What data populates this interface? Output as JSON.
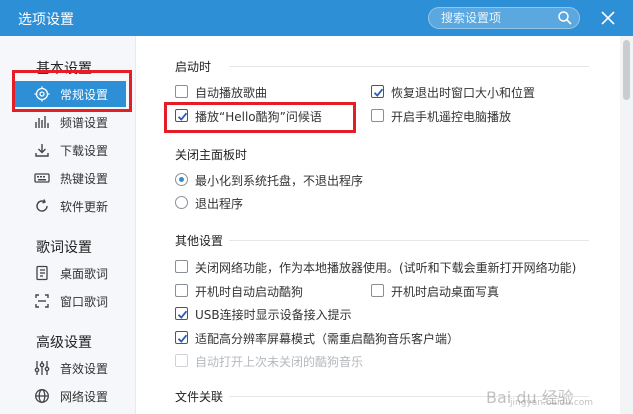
{
  "window": {
    "title": "选项设置"
  },
  "search": {
    "placeholder": "搜索设置项"
  },
  "sidebar": {
    "groups": [
      {
        "title": "基本设置",
        "items": [
          {
            "label": "常规设置",
            "icon": "settings-icon",
            "active": true
          },
          {
            "label": "频谱设置",
            "icon": "spectrum-icon"
          },
          {
            "label": "下载设置",
            "icon": "download-icon"
          },
          {
            "label": "热键设置",
            "icon": "keyboard-icon"
          },
          {
            "label": "软件更新",
            "icon": "update-icon"
          }
        ]
      },
      {
        "title": "歌词设置",
        "items": [
          {
            "label": "桌面歌词",
            "icon": "desktop-lyrics-icon"
          },
          {
            "label": "窗口歌词",
            "icon": "window-lyrics-icon"
          }
        ]
      },
      {
        "title": "高级设置",
        "items": [
          {
            "label": "音效设置",
            "icon": "equalizer-icon"
          },
          {
            "label": "网络设置",
            "icon": "network-icon"
          }
        ]
      }
    ]
  },
  "main": {
    "startup": {
      "title": "启动时",
      "auto_play": "自动播放歌曲",
      "restore_window": "恢复退出时窗口大小和位置",
      "play_hello": "播放“Hello酷狗”问候语",
      "phone_remote": "开启手机遥控电脑播放"
    },
    "close_panel": {
      "title": "关闭主面板时",
      "minimize": "最小化到系统托盘，不退出程序",
      "exit": "退出程序"
    },
    "other": {
      "title": "其他设置",
      "disable_network": "关闭网络功能，作为本地播放器使用。(试听和下载会重新打开网络功能)",
      "autostart": "开机时自动启动酷狗",
      "desktop_photo": "开机时启动桌面写真",
      "usb_prompt": "USB连接时显示设备接入提示",
      "hidpi": "适配高分辨率屏幕模式（需重启酷狗音乐客户端）",
      "reopen_last": "自动打开上次未关闭的酷狗音乐"
    },
    "file_assoc": {
      "title": "文件关联"
    }
  },
  "watermark": {
    "text": "Bai du 经验",
    "sub": "jingyan.baidu.com"
  },
  "colors": {
    "accent": "#2d8fd6",
    "highlight": "#e41e26"
  }
}
